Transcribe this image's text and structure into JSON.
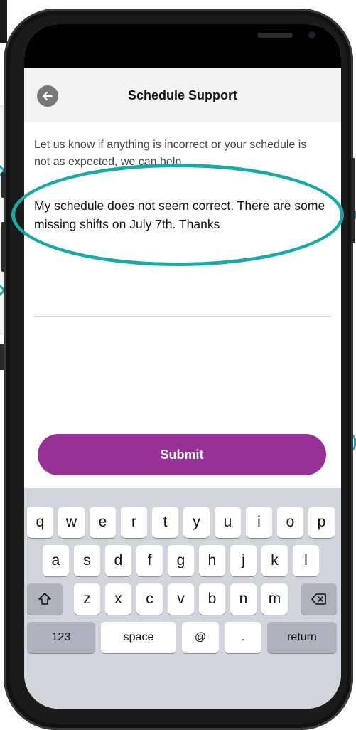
{
  "header": {
    "title": "Schedule Support"
  },
  "form": {
    "info_text": "Let us know if anything is incorrect or your schedule is not as expected, we can help.",
    "message_value": "My schedule does not seem correct. There are some missing shifts on July 7th. Thanks",
    "submit_label": "Submit"
  },
  "keyboard": {
    "row1": [
      "q",
      "w",
      "e",
      "r",
      "t",
      "y",
      "u",
      "i",
      "o",
      "p"
    ],
    "row2": [
      "a",
      "s",
      "d",
      "f",
      "g",
      "h",
      "j",
      "k",
      "l"
    ],
    "row3": [
      "z",
      "x",
      "c",
      "v",
      "b",
      "n",
      "m"
    ],
    "numbers_label": "123",
    "space_label": "space",
    "at_label": "@",
    "period_label": ".",
    "return_label": "return"
  },
  "colors": {
    "accent": "#983196",
    "highlight": "#17aaa6",
    "header_bg": "#f3f3f3",
    "keyboard_bg": "#d1d4db"
  },
  "icons": [
    "back-arrow-icon",
    "shift-icon",
    "backspace-icon",
    "chevron-right-icon"
  ]
}
